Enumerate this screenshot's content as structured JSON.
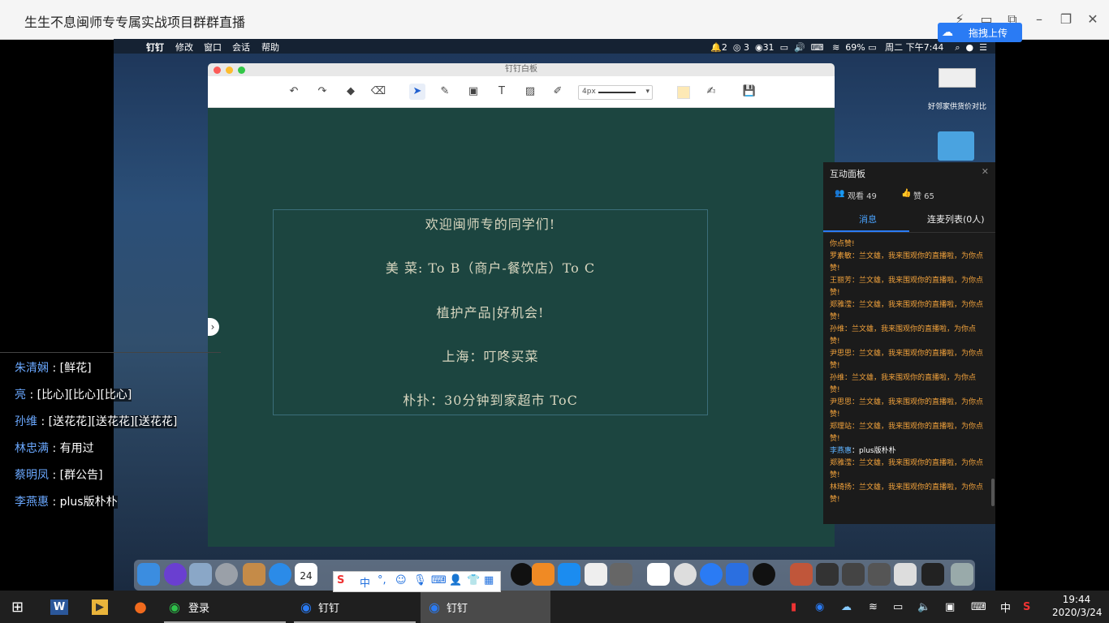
{
  "window": {
    "title": "生生不息闽师专专属实战项目群群直播",
    "upload_button": "拖拽上传"
  },
  "mac_menubar": {
    "app": "钉钉",
    "items": [
      "修改",
      "窗口",
      "会话",
      "帮助"
    ],
    "status": {
      "notif_count": "2",
      "wechat_count": "3",
      "other_count": "31",
      "battery": "69%",
      "datetime": "周二 下午7:44"
    }
  },
  "whiteboard": {
    "title": "钉钉白板",
    "stroke_size": "4px",
    "lines": [
      "欢迎闽师专的同学们!",
      "美 菜: To B（商户-餐饮店）To C",
      "植护产品|好机会!",
      "上海：叮咚买菜",
      "朴扑：30分钟到家超市 ToC"
    ]
  },
  "desktop": {
    "icon1_label": "好邻家供货价对比"
  },
  "panel": {
    "title": "互动面板",
    "viewers": "观看 49",
    "likes": "赞 65",
    "tab_messages": "消息",
    "tab_mic": "连麦列表(0人)",
    "messages": [
      {
        "name": "",
        "text": "你点赞!"
      },
      {
        "name": "罗素敏",
        "text": "：兰文雄，我来围观你的直播啦，为你点赞!"
      },
      {
        "name": "王丽芳",
        "text": "：兰文雄，我来围观你的直播啦，为你点赞!"
      },
      {
        "name": "郑雅滢",
        "text": "：兰文雄，我来围观你的直播啦，为你点赞!"
      },
      {
        "name": "孙维",
        "text": "：兰文雄，我来围观你的直播啦，为你点赞!"
      },
      {
        "name": "尹思思",
        "text": "：兰文雄，我来围观你的直播啦，为你点赞!"
      },
      {
        "name": "孙维",
        "text": "：兰文雄，我来围观你的直播啦，为你点赞!"
      },
      {
        "name": "尹思思",
        "text": "：兰文雄，我来围观你的直播啦，为你点赞!"
      },
      {
        "name": "郑理站",
        "text": "：兰文雄，我来围观你的直播啦，为你点赞!"
      },
      {
        "name": "李燕惠",
        "text": "：plus版朴朴",
        "highlight": true
      },
      {
        "name": "郑雅滢",
        "text": "：兰文雄，我来围观你的直播啦，为你点赞!"
      },
      {
        "name": "林琦扬",
        "text": "：兰文雄，我来围观你的直播啦，为你点赞!"
      }
    ]
  },
  "danmaku": [
    {
      "name": "朱清娴",
      "content": "[鲜花]"
    },
    {
      "name": "亮",
      "content": "[比心][比心][比心]"
    },
    {
      "name": "孙维",
      "content": "[送花花][送花花][送花花]"
    },
    {
      "name": "林忠满",
      "content": "有用过"
    },
    {
      "name": "蔡明凤",
      "content": "[群公告]"
    },
    {
      "name": "李燕惠",
      "content": "plus版朴朴"
    }
  ],
  "dock": {
    "calendar_day": "24",
    "ime": {
      "lang": "中"
    }
  },
  "taskbar": {
    "wechat_label": "登录",
    "dingtalk1_label": "钉钉",
    "dingtalk2_label": "钉钉",
    "ime_lang": "中",
    "time": "19:44",
    "date": "2020/3/24"
  },
  "colors": {
    "whiteboard_bg": "#1c4540",
    "panel_msg": "#f3a33c",
    "chat_name": "#6aa8ff",
    "upload_btn": "#2a7bf4"
  }
}
